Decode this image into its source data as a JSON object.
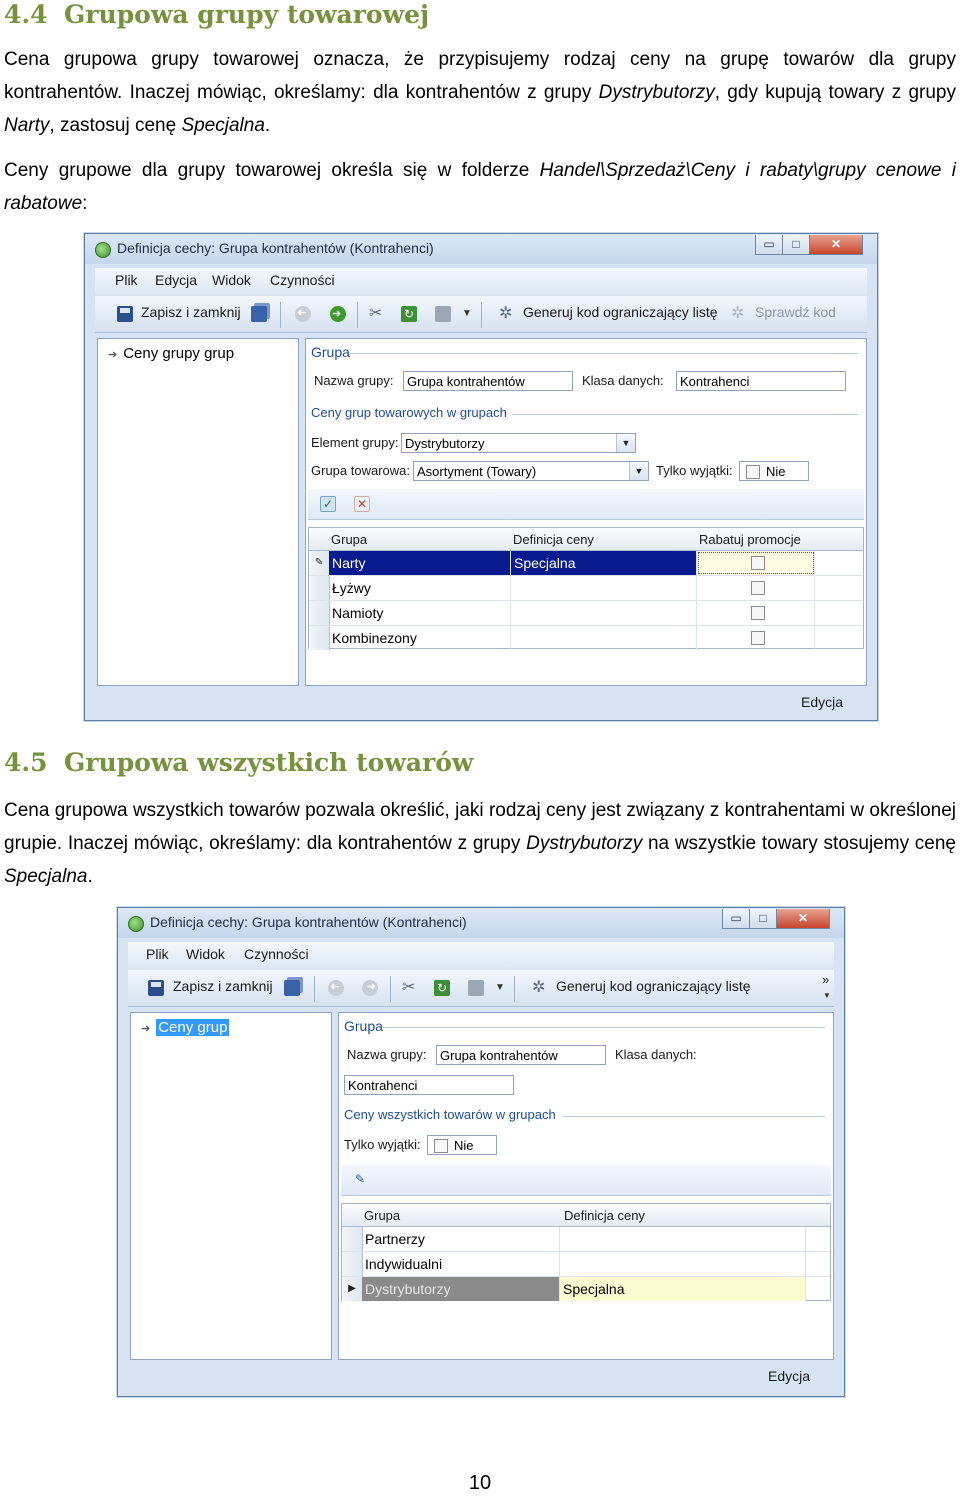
{
  "section1": {
    "number": "4.4",
    "title": "Grupowa grupy towarowej",
    "p1_a": "Cena grupowa grupy towarowej oznacza, że przypisujemy rodzaj ceny na grupę towarów dla grupy kontrahentów. Inaczej mówiąc, określamy: dla kontrahentów z grupy ",
    "p1_i1": "Dystrybutorzy",
    "p1_b": ", gdy kupują towary z grupy ",
    "p1_i2": "Narty",
    "p1_c": ", zastosuj cenę ",
    "p1_i3": "Specjalna",
    "p1_d": ".",
    "p2_a": "Ceny grupowe dla grupy towarowej określa się w folderze ",
    "p2_i1": "Handel\\Sprzedaż\\Ceny i rabaty\\grupy cenowe i rabatowe",
    "p2_b": ":"
  },
  "window1": {
    "title": "Definicja cechy: Grupa kontrahentów (Kontrahenci)",
    "menu": [
      "Plik",
      "Edycja",
      "Widok",
      "Czynności"
    ],
    "toolbar": {
      "save_close": "Zapisz i zamknij",
      "gen_code": "Generuj kod ograniczający listę",
      "check_code": "Sprawdź kod"
    },
    "tree_item": "Ceny grupy grup",
    "group_caption": "Grupa",
    "name_label": "Nazwa grupy:",
    "name_value": "Grupa kontrahentów",
    "class_label": "Klasa danych:",
    "class_value": "Kontrahenci",
    "subgroup_caption": "Ceny grup towarowych w grupach",
    "element_label": "Element grupy:",
    "element_value": "Dystrybutorzy",
    "goods_label": "Grupa towarowa:",
    "goods_value": "Asortyment (Towary)",
    "exceptions_label": "Tylko wyjątki:",
    "exceptions_value": "Nie",
    "columns": [
      "Grupa",
      "Definicja ceny",
      "Rabatuj promocje"
    ],
    "rows": [
      {
        "group": "Narty",
        "price": "Specjalna"
      },
      {
        "group": "Łyżwy",
        "price": ""
      },
      {
        "group": "Namioty",
        "price": ""
      },
      {
        "group": "Kombinezony",
        "price": ""
      }
    ],
    "status": "Edycja"
  },
  "section2": {
    "number": "4.5",
    "title": "Grupowa wszystkich towarów",
    "p1_a": "Cena grupowa wszystkich towarów pozwala określić, jaki rodzaj ceny jest związany z kontrahentami w określonej grupie. Inaczej mówiąc, określamy: dla kontrahentów z grupy ",
    "p1_i1": "Dystrybutorzy",
    "p1_b": " na wszystkie towary stosujemy cenę ",
    "p1_i2": "Specjalna",
    "p1_c": "."
  },
  "window2": {
    "title": "Definicja cechy: Grupa kontrahentów (Kontrahenci)",
    "menu": [
      "Plik",
      "Widok",
      "Czynności"
    ],
    "toolbar": {
      "save_close": "Zapisz i zamknij",
      "gen_code": "Generuj kod ograniczający listę",
      "more": "»"
    },
    "tree_item": "Ceny grup",
    "group_caption": "Grupa",
    "name_label": "Nazwa grupy:",
    "name_value": "Grupa kontrahentów",
    "class_label": "Klasa danych:",
    "class_value": "Kontrahenci",
    "subgroup_caption": "Ceny wszystkich towarów w grupach",
    "exceptions_label": "Tylko wyjątki:",
    "exceptions_value": "Nie",
    "columns": [
      "Grupa",
      "Definicja ceny"
    ],
    "rows": [
      {
        "group": "Partnerzy",
        "price": ""
      },
      {
        "group": "Indywidualni",
        "price": ""
      },
      {
        "group": "Dystrybutorzy",
        "price": "Specjalna"
      }
    ],
    "status": "Edycja"
  },
  "page_number": "10",
  "colors": {
    "heading": "#76923c",
    "selection": "#0a1a8f",
    "link_blue": "#1e4d9a"
  }
}
